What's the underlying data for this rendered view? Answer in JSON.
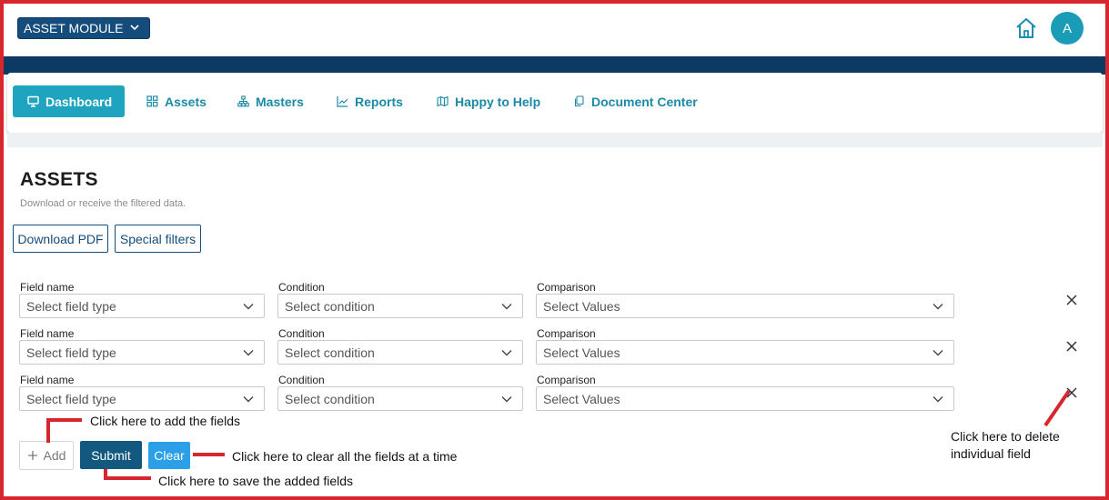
{
  "header": {
    "module_label": "ASSET MODULE",
    "avatar_initial": "A"
  },
  "nav": {
    "tabs": [
      {
        "label": "Dashboard",
        "icon": "monitor-icon",
        "active": true
      },
      {
        "label": "Assets",
        "icon": "grid-icon",
        "active": false
      },
      {
        "label": "Masters",
        "icon": "hierarchy-icon",
        "active": false
      },
      {
        "label": "Reports",
        "icon": "line-chart-icon",
        "active": false
      },
      {
        "label": "Happy to Help",
        "icon": "map-icon",
        "active": false
      },
      {
        "label": "Document Center",
        "icon": "copy-icon",
        "active": false
      }
    ]
  },
  "page": {
    "title": "ASSETS",
    "subtitle": "Download or receive the filtered data.",
    "download_pdf_label": "Download PDF",
    "special_filters_label": "Special filters"
  },
  "filters": {
    "rows": [
      {
        "field_label": "Field name",
        "field_placeholder": "Select field type",
        "condition_label": "Condition",
        "condition_placeholder": "Select condition",
        "comparison_label": "Comparison",
        "comparison_placeholder": "Select Values"
      },
      {
        "field_label": "Field name",
        "field_placeholder": "Select field type",
        "condition_label": "Condition",
        "condition_placeholder": "Select condition",
        "comparison_label": "Comparison",
        "comparison_placeholder": "Select Values"
      },
      {
        "field_label": "Field name",
        "field_placeholder": "Select field type",
        "condition_label": "Condition",
        "condition_placeholder": "Select condition",
        "comparison_label": "Comparison",
        "comparison_placeholder": "Select Values"
      }
    ]
  },
  "actions": {
    "add_label": "Add",
    "submit_label": "Submit",
    "clear_label": "Clear"
  },
  "annotations": {
    "add_hint": "Click here to add the fields",
    "clear_hint": "Click here to clear all the fields at a time",
    "submit_hint": "Click here to save the added fields",
    "delete_hint_line1": "Click here to delete",
    "delete_hint_line2": "individual field"
  },
  "colors": {
    "frame": "#d7262e",
    "navy": "#0d3a63",
    "accent": "#1fa4bf",
    "submit": "#13587f",
    "clear": "#2b9fe8"
  }
}
